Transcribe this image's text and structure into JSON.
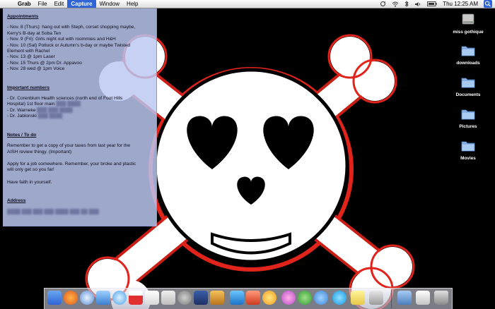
{
  "menubar": {
    "app_name": "Grab",
    "items": [
      "File",
      "Edit",
      "Capture",
      "Window",
      "Help"
    ],
    "active_item": "Capture",
    "clock": "Thu 12:25 AM",
    "active_color": "#2f63d6"
  },
  "note": {
    "sections": [
      {
        "heading": "Appointments",
        "lines": [
          "- Nov. 8 (Thurs): hang out with Steph, corset shopping maybe,",
          "Kerry's B-day at Soba Ten",
          "- Nov. 9 (Fri): Girls night out with roommies and H&H",
          "- Nov. 10 (Sat) Potluck or Autumn's b-day or maybe Twisted",
          "Element with Rachel",
          "- Nov. 13 @ 1pm Laser",
          "- Nov. 15 Thurs @ 2pm Dr. Appavoo",
          "- Nov. 28 wed @ 1pm Voice"
        ]
      },
      {
        "heading": "Important numbers",
        "lines": [
          "- Dr. Corenblum Health sciences (north end of Foot Hills",
          "Hospital) 1st floor main",
          "- Dr. Warneke",
          "- Dr. Jablonski"
        ]
      },
      {
        "heading": "Notes / To do",
        "lines": [
          "Remember to get a copy of your taxes from last year for the",
          "AISH review thingy. (Important)",
          "",
          "Apply for a job somewhere. Remember, your broke and plastic",
          "will only get so you far!",
          "",
          "Have faith in yourself."
        ]
      },
      {
        "heading": "Address",
        "lines": []
      }
    ],
    "background": "#bbc8f2"
  },
  "desktop_icons": [
    {
      "label": "miss gothique",
      "icon": "hard-drive-icon"
    },
    {
      "label": "downloads",
      "icon": "folder-icon"
    },
    {
      "label": "Documents",
      "icon": "folder-icon"
    },
    {
      "label": "Pictures",
      "icon": "folder-icon"
    },
    {
      "label": "Movies",
      "icon": "folder-icon"
    }
  ],
  "dock": {
    "icons": [
      "finder-icon",
      "firefox-icon",
      "safari-icon",
      "mail-icon",
      "itunes-icon",
      "ical-icon",
      "textedit-icon",
      "preview-icon",
      "system-prefs-icon",
      "imovie-icon",
      "garageband-icon",
      "pencil-app-icon",
      "app-icon",
      "flower-app-icon",
      "butterfly-app-icon",
      "messenger-icon",
      "chat-icon",
      "skype-icon",
      "stickies-icon",
      "grab-icon",
      "applications-folder-icon",
      "documents-stack-icon",
      "trash-icon"
    ]
  },
  "wallpaper": {
    "skull_color": "#ffffff",
    "outline_color": "#e0241c",
    "background": "#000000"
  }
}
